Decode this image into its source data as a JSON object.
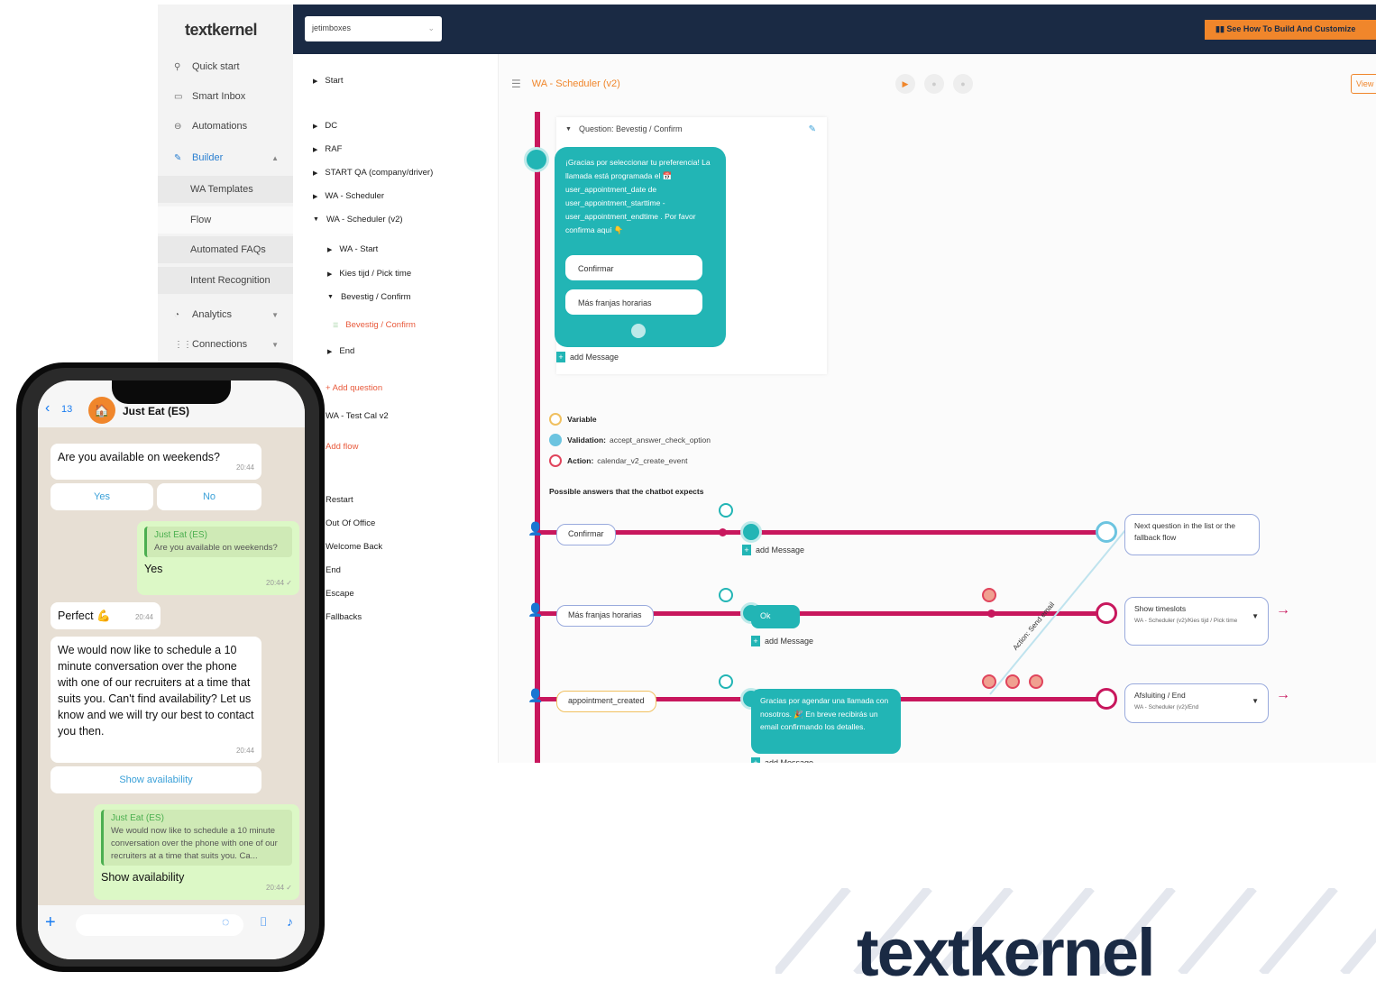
{
  "sidebar": {
    "logo": "textkernel",
    "items": [
      {
        "label": "Quick start",
        "icon": "rocket-icon"
      },
      {
        "label": "Smart Inbox",
        "icon": "inbox-icon"
      },
      {
        "label": "Automations",
        "icon": "robot-icon"
      },
      {
        "label": "Builder",
        "icon": "pencil-icon"
      },
      {
        "label": "WA Templates"
      },
      {
        "label": "Flow"
      },
      {
        "label": "Automated FAQs"
      },
      {
        "label": "Intent Recognition"
      },
      {
        "label": "Analytics",
        "icon": "chart-icon"
      },
      {
        "label": "Connections",
        "icon": "grid-icon"
      }
    ]
  },
  "topbar": {
    "bot_select": "jetimboxes",
    "cta": "See How To Build And Customize"
  },
  "tree": {
    "items": [
      "Start",
      "DC",
      "RAF",
      "START QA (company/driver)",
      "WA - Scheduler",
      "WA - Scheduler (v2)",
      "WA - Start",
      "Kies tijd / Pick time",
      "Bevestig / Confirm",
      "Bevestig / Confirm",
      "End",
      "+ Add question",
      "WA - Test Cal v2",
      "Add flow",
      "Restart",
      "Out Of Office",
      "Welcome Back",
      "End",
      "Escape",
      "Fallbacks"
    ]
  },
  "canvas": {
    "title": "WA - Scheduler (v2)",
    "view_button": "View",
    "question_header": "Question: Bevestig / Confirm",
    "question_text": "¡Gracias por seleccionar tu preferencia! La llamada está programada el 📅 user_appointment_date de user_appointment_starttime - user_appointment_endtime . Por favor confirma aquí 👇",
    "question_buttons": [
      "Confirmar",
      "Más franjas horarias"
    ],
    "add_message": "add Message",
    "variable_label": "Variable",
    "validation_label": "Validation:",
    "validation_value": "accept_answer_check_option",
    "action_label": "Action:",
    "action_value": "calendar_v2_create_event",
    "possible_answers": "Possible answers that the chatbot expects",
    "answers": [
      "Confirmar",
      "Más franjas horarias",
      "appointment_created"
    ],
    "ok_label": "Ok",
    "reply_text": "Gracias por agendar una llamada con nosotros. 🎉 En breve recibirás un email confirmando los detalles.",
    "diag_label": "Action: Send email",
    "next_boxes": [
      {
        "title": "Next question in the list or the fallback flow",
        "sub": ""
      },
      {
        "title": "Show timeslots",
        "sub": "WA - Scheduler (v2)/Kies tijd / Pick time"
      },
      {
        "title": "Afsluiting / End",
        "sub": "WA - Scheduler (v2)/End"
      }
    ]
  },
  "phone": {
    "back_count": "13",
    "contact": "Just Eat (ES)",
    "messages": {
      "q1": "Are you available on weekends?",
      "t1": "20:44",
      "yes": "Yes",
      "no": "No",
      "quote_who": "Just Eat (ES)",
      "quote_text": "Are you available on weekends?",
      "reply": "Yes",
      "t2": "20:44 ✓",
      "perfect": "Perfect 💪",
      "t3": "20:44",
      "long": "We would now like to schedule a 10 minute conversation over the phone with one of our recruiters at a time that suits you. Can't find availability? Let us know and we will try our best to contact you then.",
      "t4": "20:44",
      "show": "Show availability",
      "quote2_who": "Just Eat (ES)",
      "quote2_text": "We would now like to schedule a 10 minute conversation over the phone with one of our recruiters at a time that suits you. Ca...",
      "reply2": "Show availability",
      "t5": "20:44 ✓"
    }
  },
  "brand": {
    "logo_text": "textkernel",
    "navy": "#1a2a44",
    "orange": "#f0862b",
    "teal": "#22b5b5",
    "magenta": "#c8175d"
  }
}
